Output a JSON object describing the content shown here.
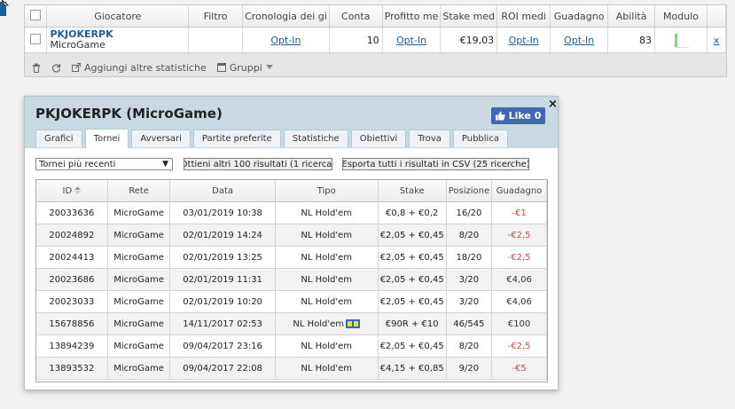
{
  "players_table": {
    "headers": [
      "Giocatore",
      "Filtro",
      "Cronologia dei gi",
      "Conta",
      "Profitto me",
      "Stake med",
      "ROI medi",
      "Guadagno",
      "Abilità",
      "Modulo"
    ],
    "row": {
      "name": "PKJOKERPK",
      "network": "MicroGame",
      "filter": "",
      "history": "Opt-In",
      "count": "10",
      "avg_profit": "Opt-In",
      "avg_stake": "€19,03",
      "avg_roi": "Opt-In",
      "earnings": "Opt-In",
      "ability": "83",
      "remove": "x"
    },
    "form_bar_level": 1.0
  },
  "toolbar": {
    "add_stats_label": "Aggiungi altre statistiche",
    "groups_label": "Gruppi"
  },
  "popup": {
    "title": "PKJOKERPK (MicroGame)",
    "like_label": "Like 0",
    "close_label": "×",
    "tabs": [
      "Grafici",
      "Tornei",
      "Avversari",
      "Partite preferite",
      "Statistiche",
      "Obiettivi",
      "Trova",
      "Pubblica"
    ],
    "active_tab": "Tornei",
    "select_value": "Tornei più recenti",
    "button_more": "Ottieni altri 100 risultati (1 ricerca)",
    "button_csv": "Esporta tutti i risultati in CSV (25  ricerche)",
    "results": {
      "headers": [
        "ID",
        "Rete",
        "Data",
        "Tipo",
        "Stake",
        "Posizione",
        "Guadagno"
      ],
      "rows": [
        {
          "id": "20033636",
          "network": "MicroGame",
          "date": "03/01/2019 10:38",
          "type": "NL Hold'em",
          "stake": "€0,8 + €0,2",
          "position": "16/20",
          "earnings": "-€1",
          "negative": true
        },
        {
          "id": "20024892",
          "network": "MicroGame",
          "date": "02/01/2019 14:24",
          "type": "NL Hold'em",
          "stake": "€2,05 + €0,45",
          "position": "8/20",
          "earnings": "-€2,5",
          "negative": true
        },
        {
          "id": "20024413",
          "network": "MicroGame",
          "date": "02/01/2019 13:25",
          "type": "NL Hold'em",
          "stake": "€2,05 + €0,45",
          "position": "18/20",
          "earnings": "-€2,5",
          "negative": true
        },
        {
          "id": "20023686",
          "network": "MicroGame",
          "date": "02/01/2019 11:31",
          "type": "NL Hold'em",
          "stake": "€2,05 + €0,45",
          "position": "3/20",
          "earnings": "€4,06",
          "negative": false
        },
        {
          "id": "20023033",
          "network": "MicroGame",
          "date": "02/01/2019 10:20",
          "type": "NL Hold'em",
          "stake": "€2,05 + €0,45",
          "position": "3/20",
          "earnings": "€4,06",
          "negative": false
        },
        {
          "id": "15678856",
          "network": "MicroGame",
          "date": "14/11/2017 02:53",
          "type": "NL Hold'em",
          "stake": "€90R + €10",
          "position": "46/545",
          "earnings": "€100",
          "negative": false,
          "turbo": true
        },
        {
          "id": "13894239",
          "network": "MicroGame",
          "date": "09/04/2017 23:16",
          "type": "NL Hold'em",
          "stake": "€2,05 + €0,45",
          "position": "8/20",
          "earnings": "-€2,5",
          "negative": true
        },
        {
          "id": "13893532",
          "network": "MicroGame",
          "date": "09/04/2017 22:08",
          "type": "NL Hold'em",
          "stake": "€4,15 + €0,85",
          "position": "9/20",
          "earnings": "-€5",
          "negative": true
        }
      ]
    }
  },
  "colors": {
    "link": "#1d5e9b",
    "negative": "#c0504d",
    "header_band": "#c9d9e2",
    "facebook": "#4267b2",
    "form_bar": "#7fd67f"
  }
}
